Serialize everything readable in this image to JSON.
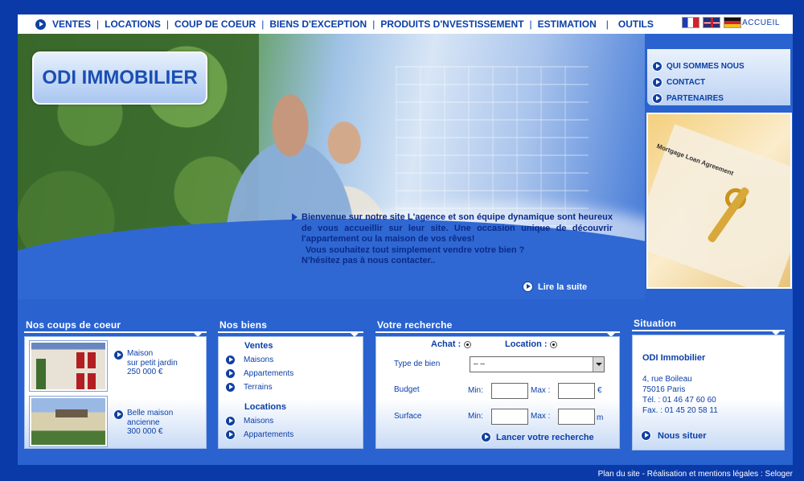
{
  "nav": {
    "items": [
      "VENTES",
      "LOCATIONS",
      "COUP DE COEUR",
      "BIENS D'EXCEPTION",
      "PRODUITS D'NVESTISSEMENT",
      "ESTIMATION",
      "OUTILS"
    ],
    "accueil": "ACCUEIL",
    "flags": [
      "flag-fr",
      "flag-uk",
      "flag-de"
    ]
  },
  "logo": "ODI IMMOBILIER",
  "welcome": "Bienvenue sur notre site L'agence et son équipe dynamique sont heureux de vous accueillir sur leur site. Une occasion unique de découvrir l'appartement ou la maison de vos rêves!  Vous souhaitez tout simplement vendre votre bien ? N'hésitez pas à nous contacter..",
  "welcome_lines": [
    "Bienvenue sur notre site L'agence et son équipe dynamique sont heureux de vous accueillir sur leur site. Une occasion unique de découvrir l'appartement ou la maison de vos rêves!",
    "Vous souhaitez tout simplement vendre votre bien ?",
    "N'hésitez pas à nous contacter.."
  ],
  "read_more": "Lire la suite",
  "side_menu": [
    "QUI SOMMES NOUS",
    "CONTACT",
    "PARTENAIRES"
  ],
  "keys_image_text": "Mortgage Loan Agreement",
  "coups": {
    "title": "Nos coups de coeur",
    "items": [
      {
        "name": "Maison",
        "desc": "sur petit jardin",
        "price": "250 000 €"
      },
      {
        "name": "Belle maison",
        "desc": "ancienne",
        "price": "300 000 €"
      }
    ]
  },
  "biens": {
    "title": "Nos biens",
    "ventes_label": "Ventes",
    "ventes": [
      "Maisons",
      "Appartements",
      "Terrains"
    ],
    "locations_label": "Locations",
    "locations": [
      "Maisons",
      "Appartements"
    ]
  },
  "recherche": {
    "title": "Votre recherche",
    "achat": "Achat :",
    "location": "Location :",
    "type_label": "Type de bien",
    "type_value": "– –",
    "budget_label": "Budget",
    "surface_label": "Surface",
    "min": "Min:",
    "max": "Max :",
    "euro": "€",
    "m": "m",
    "submit": "Lancer votre recherche"
  },
  "situation": {
    "title": "Situation",
    "company": "ODI Immobilier",
    "address1": "4, rue Boileau",
    "address2": "75016 Paris",
    "tel": "Tél. : 01 46 47 60 60",
    "fax": "Fax. : 01 45 20 58 11",
    "locate": "Nous situer"
  },
  "footer": {
    "plan": "Plan du site",
    "dash": " - ",
    "mentions": "Réalisation et mentions légales",
    "colon": " : ",
    "seloger": "Seloger"
  },
  "colors": {
    "brand_blue": "#0b3fa8",
    "page_bg": "#0a3aa8",
    "panel_blue": "#2a63cf"
  }
}
